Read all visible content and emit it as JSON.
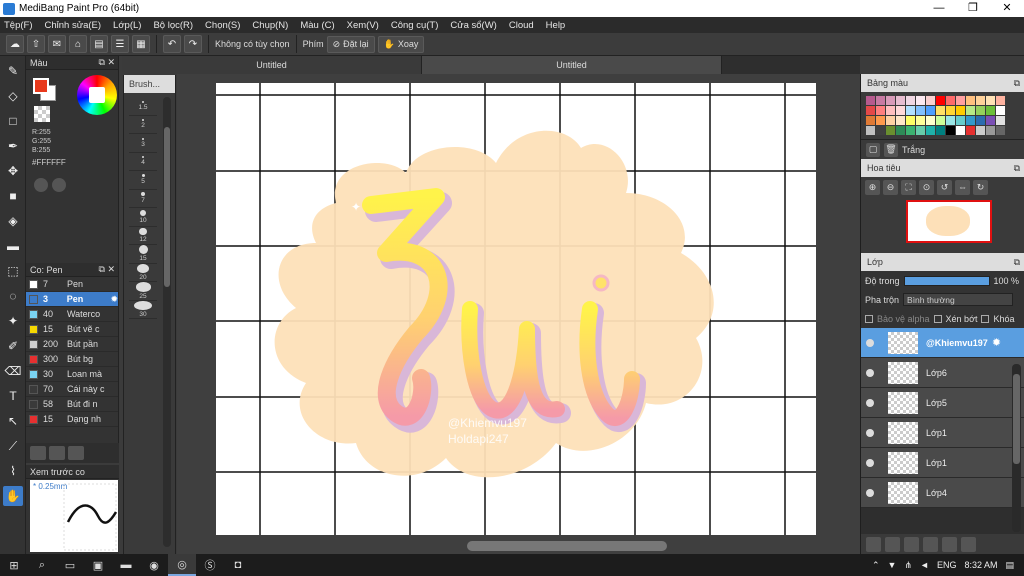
{
  "window": {
    "title": "MediBang Paint Pro (64bit)",
    "min": "—",
    "max": "❐",
    "close": "✕"
  },
  "menu": [
    "Tệp(F)",
    "Chỉnh sửa(E)",
    "Lớp(L)",
    "Bộ lọc(R)",
    "Chọn(S)",
    "Chụp(N)",
    "Màu (C)",
    "Xem(V)",
    "Công cụ(T)",
    "Cửa sổ(W)",
    "Cloud",
    "Help"
  ],
  "toolbar": {
    "no_option": "Không có tùy chọn",
    "key_label": "Phím",
    "reset": "Đặt lại",
    "rotate": "Xoay"
  },
  "color_panel": {
    "title": "Màu",
    "r": "R:255",
    "g": "G:255",
    "b": "B:255",
    "hex": "#FFFFFF",
    "fg_color": "#e8391c",
    "bg_color": "#ffffff"
  },
  "brush_panel": {
    "title": "Co: Pen",
    "brushes": [
      {
        "size": "7",
        "name": "Pen",
        "color": "#ffffff"
      },
      {
        "size": "3",
        "name": "Pen",
        "color": "#3d7cc9",
        "selected": true
      },
      {
        "size": "40",
        "name": "Waterco",
        "color": "#7ad3f2"
      },
      {
        "size": "15",
        "name": "Bút vẽ c",
        "color": "#f5d800"
      },
      {
        "size": "200",
        "name": "Bút pần",
        "color": "#cfcfcf"
      },
      {
        "size": "300",
        "name": "Bút bg",
        "color": "#e53030"
      },
      {
        "size": "30",
        "name": "Loan mà",
        "color": "#7ad3f2"
      },
      {
        "size": "70",
        "name": "Cái này c",
        "color": "#3a3a3a"
      },
      {
        "size": "58",
        "name": "Bút đi n",
        "color": "#3a3a3a"
      },
      {
        "size": "15",
        "name": "Dạng nh",
        "color": "#e53030"
      }
    ]
  },
  "preview_panel": {
    "title": "Xem trước co",
    "size": "* 0.25mm"
  },
  "brush_size_panel": {
    "title": "Brush...",
    "sizes": [
      "1.5",
      "2",
      "3",
      "4",
      "5",
      "7",
      "10",
      "12",
      "15",
      "20",
      "25",
      "30"
    ]
  },
  "tabs": [
    "Untitled",
    "Untitled"
  ],
  "canvas": {
    "watermark_line1": "@Khiemvu197",
    "watermark_line2": "Holdapi247",
    "artwork_text": "Zui"
  },
  "palette_panel": {
    "title": "Bảng màu",
    "selected_label": "Trắng",
    "colors": [
      "#b65a8e",
      "#c77aa3",
      "#d89bb9",
      "#e7bdd0",
      "#f0d7e3",
      "#fbe9f1",
      "#f9d0d0",
      "#ff0000",
      "#ff6a6a",
      "#ffa0a0",
      "#ffc07f",
      "#ffd29a",
      "#ffe2b5",
      "#ffb3a0",
      "#e54848",
      "#ff7f7f",
      "#ffbfbf",
      "#ffd9d9",
      "#b0e0ff",
      "#80c0ff",
      "#4d9fff",
      "#ffe066",
      "#ffd633",
      "#ffcc00",
      "#b8e986",
      "#95d05c",
      "#6cbf3a",
      "#ffffff",
      "#e07a35",
      "#ff9a4d",
      "#ffd1a3",
      "#ffe6c7",
      "#ffff66",
      "#ffff99",
      "#ffffcc",
      "#ccff99",
      "#99e6e6",
      "#66cccc",
      "#3399cc",
      "#2b6cb0",
      "#7a4fb5",
      "#e0e0e0",
      "#c0c0c0",
      "#404040",
      "#6a8f2f",
      "#2e8b57",
      "#3cb371",
      "#66cdaa",
      "#20b2aa",
      "#008080",
      "#000000",
      "#ffffff",
      "#e53030",
      "#cccccc",
      "#999999",
      "#666666"
    ]
  },
  "navigator_panel": {
    "title": "Hoa tiêu"
  },
  "layer_panel": {
    "title": "Lớp",
    "opacity_label": "Độ trong",
    "opacity_value": "100 %",
    "opacity_fraction": 1.0,
    "blend_label": "Pha trộn",
    "blend_value": "Bình thường",
    "protect_alpha": "Bảo vệ alpha",
    "clip": "Xén bớt",
    "lock": "Khóa",
    "layers": [
      {
        "name": "@Khiemvu197",
        "selected": true
      },
      {
        "name": "Lớp6"
      },
      {
        "name": "Lớp5"
      },
      {
        "name": "Lớp1"
      },
      {
        "name": "Lớp1"
      },
      {
        "name": "Lớp4"
      }
    ]
  },
  "taskbar": {
    "lang": "ENG",
    "time": "8:32 AM"
  }
}
